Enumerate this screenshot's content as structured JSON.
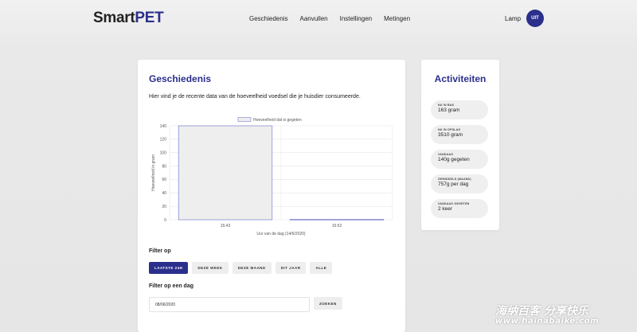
{
  "header": {
    "logo_main": "Smart",
    "logo_accent": "PET",
    "nav": [
      "Geschiedenis",
      "Aanvullen",
      "Instellingen",
      "Metingen"
    ],
    "lamp": "Lamp",
    "toggle": "UIT"
  },
  "main": {
    "title": "Geschiedenis",
    "intro": "Hier vind je de recente data van de hoeveelheid voedsel die je huisdier consumeerde.",
    "filter_label": "Filter op",
    "filters": [
      "LAATSTE 24H",
      "DEZE WEEK",
      "DEZE MAAND",
      "DIT JAAR",
      "ALLE"
    ],
    "active_filter": "LAATSTE 24H",
    "date_filter_label": "Filter op een dag",
    "date_value": "08/06/2020",
    "search_label": "ZOEKEN"
  },
  "chart_data": {
    "type": "bar",
    "categories": [
      "15:43",
      "15:52"
    ],
    "series": [
      {
        "name": "Hoeveelheid dat is gegeten",
        "values": [
          140,
          0.6
        ]
      }
    ],
    "xlabel": "Uur van de dag (14/6/2020)",
    "ylabel": "Hoeveelheid in gram",
    "ylim": [
      0,
      140
    ],
    "yticks": [
      0,
      20,
      40,
      60,
      80,
      100,
      120,
      140
    ],
    "grid": true,
    "legend": "top",
    "colors": {
      "bar_fill": "#eeeeee",
      "bar_stroke": "#7b7fcf"
    }
  },
  "activity": {
    "title": "Activiteiten",
    "items": [
      {
        "label": "NU IN BAK",
        "value": "163 gram"
      },
      {
        "label": "NU IN OPSLAG",
        "value": "3510 gram"
      },
      {
        "label": "VANDAAG",
        "value": "140g gegeten"
      },
      {
        "label": "GEMIDDELD (maand)",
        "value": "757g per dag"
      },
      {
        "label": "VANDAAG GEGETEN",
        "value": "2 keer"
      }
    ]
  },
  "watermark": {
    "line1": "海纳百客 分享快乐",
    "line2": "www.hainabaike.com"
  },
  "colors": {
    "accent": "#2b2f8c",
    "background": "#e8e8e8",
    "card": "#ffffff"
  }
}
